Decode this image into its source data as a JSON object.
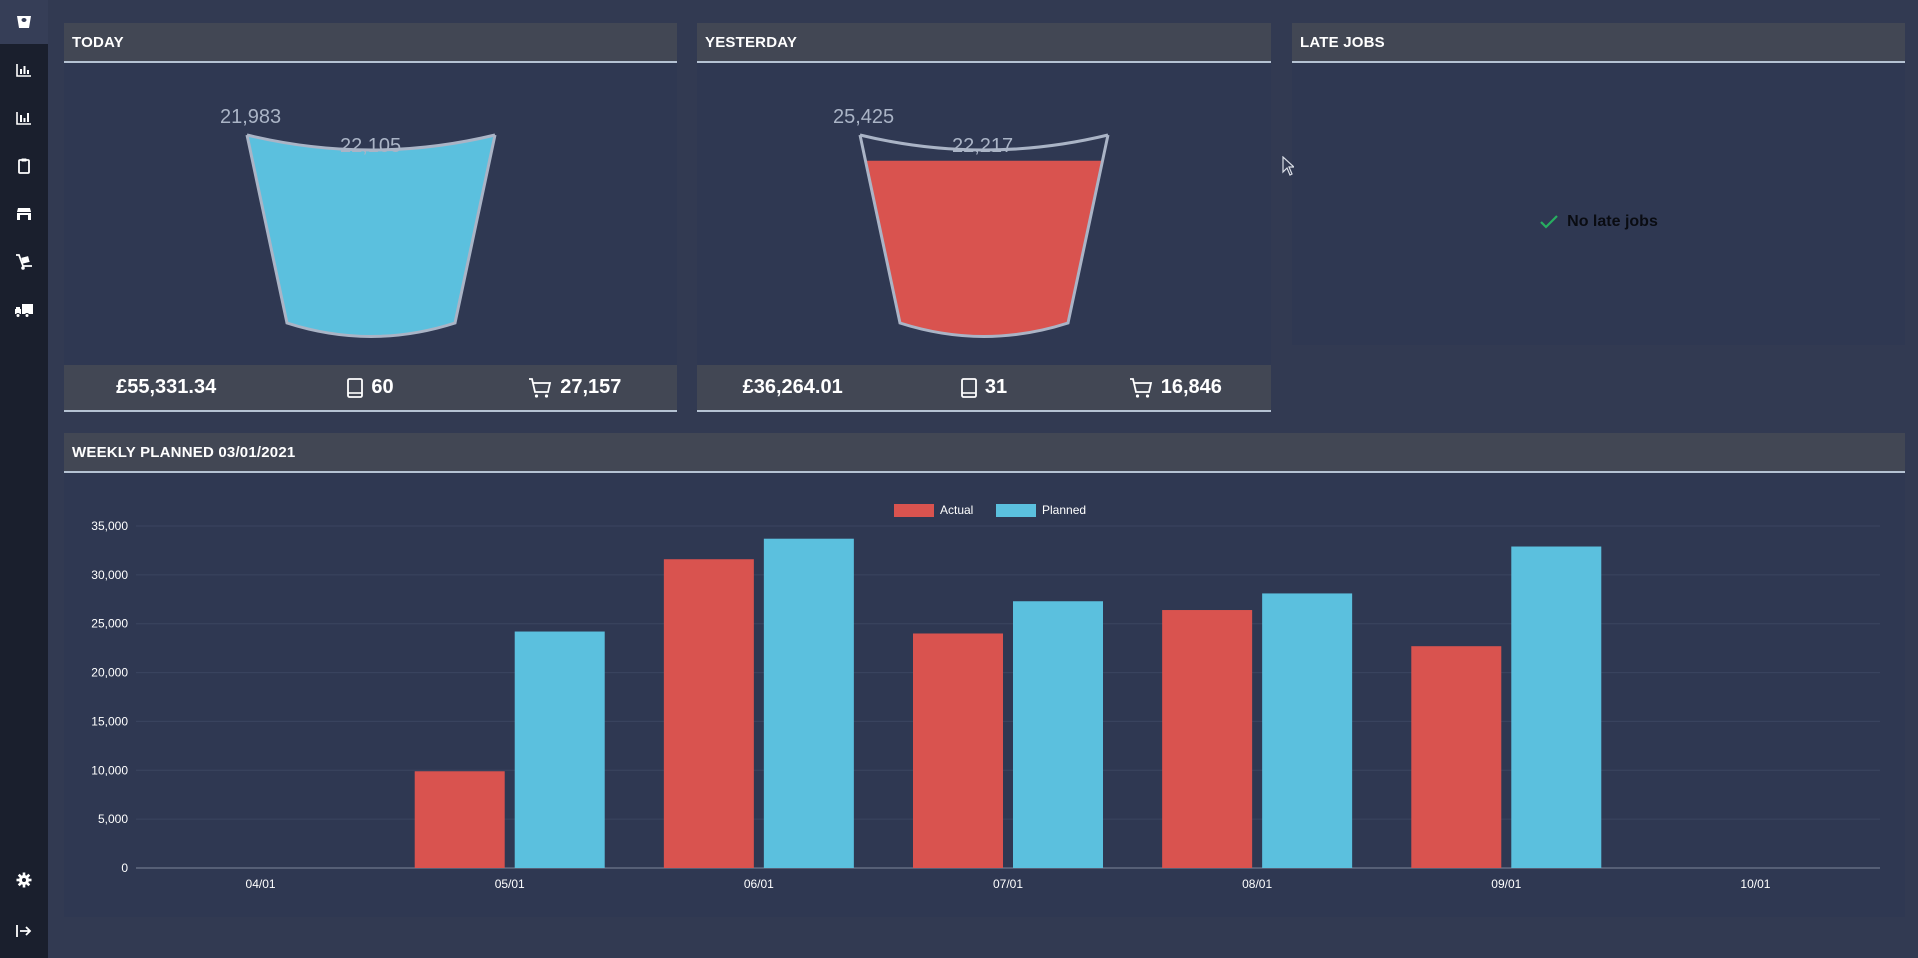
{
  "sidebar": {
    "items": [
      {
        "icon": "bucket-icon",
        "active": true
      },
      {
        "icon": "bar-chart-icon"
      },
      {
        "icon": "bar-chart-alt-icon"
      },
      {
        "icon": "clipboard-icon"
      },
      {
        "icon": "warehouse-icon"
      },
      {
        "icon": "hand-truck-icon"
      },
      {
        "icon": "delivery-truck-icon"
      }
    ],
    "bottom": [
      {
        "icon": "gear-icon"
      },
      {
        "icon": "logout-icon"
      }
    ]
  },
  "colors": {
    "today_fill": "#5bc0de",
    "yesterday_fill": "#d9534f",
    "actual": "#d9534f",
    "planned": "#5bc0de",
    "check": "#27ae60"
  },
  "today": {
    "title": "TODAY",
    "bucket_target": "21,983",
    "bucket_value": "22,105",
    "fill_fraction": 1.0,
    "revenue": "£55,331.34",
    "orders": "60",
    "items": "27,157"
  },
  "yesterday": {
    "title": "YESTERDAY",
    "bucket_target": "25,425",
    "bucket_value": "22,217",
    "fill_fraction": 0.87,
    "revenue": "£36,264.01",
    "orders": "31",
    "items": "16,846"
  },
  "late_jobs": {
    "title": "LATE JOBS",
    "message": "No late jobs"
  },
  "weekly": {
    "title": "WEEKLY PLANNED 03/01/2021"
  },
  "chart_data": {
    "type": "bar",
    "categories": [
      "04/01",
      "05/01",
      "06/01",
      "07/01",
      "08/01",
      "09/01",
      "10/01"
    ],
    "series": [
      {
        "name": "Actual",
        "values": [
          0,
          9900,
          31600,
          24000,
          26400,
          22700,
          0
        ]
      },
      {
        "name": "Planned",
        "values": [
          0,
          24200,
          33700,
          27300,
          28100,
          32900,
          0
        ]
      }
    ],
    "ylim": [
      0,
      35000
    ],
    "yticks": [
      0,
      5000,
      10000,
      15000,
      20000,
      25000,
      30000,
      35000
    ],
    "ytick_labels": [
      "0",
      "5,000",
      "10,000",
      "15,000",
      "20,000",
      "25,000",
      "30,000",
      "35,000"
    ],
    "legend": "top-center",
    "grid": true
  }
}
